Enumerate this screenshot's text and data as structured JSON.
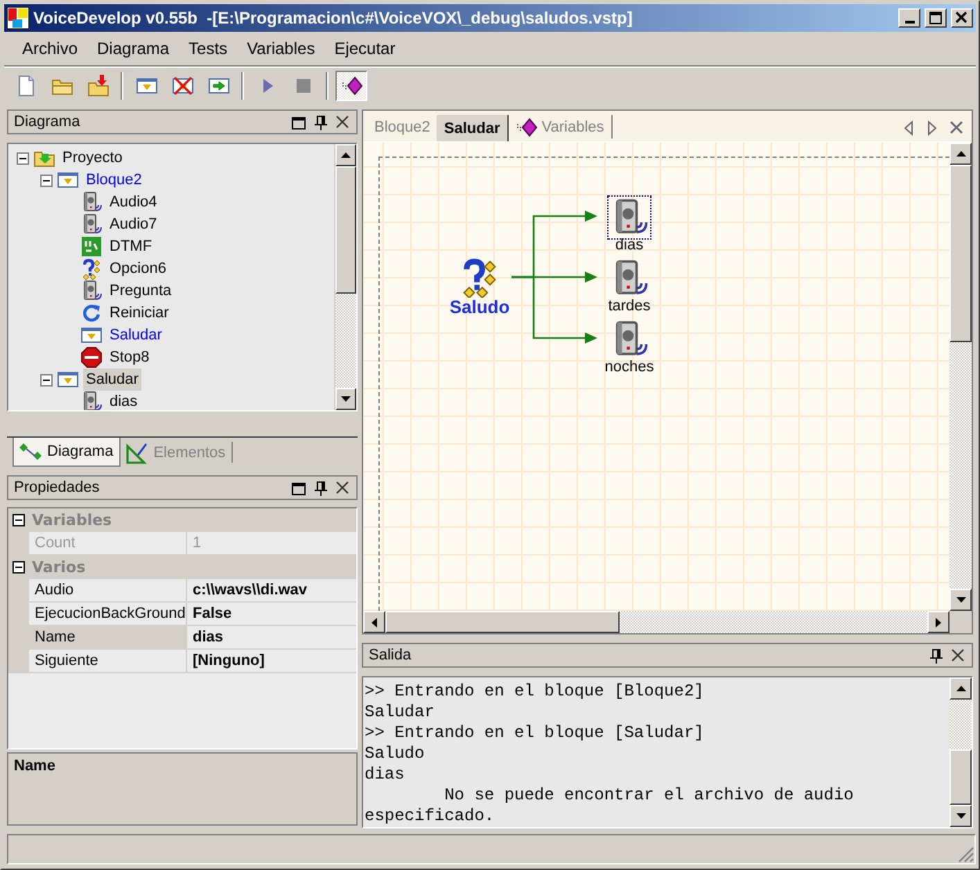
{
  "window": {
    "title": "VoiceDevelop v0.55b  -[E:\\Programacion\\c#\\VoiceVOX\\_debug\\saludos.vstp]"
  },
  "menu": [
    "Archivo",
    "Diagrama",
    "Tests",
    "Variables",
    "Ejecutar"
  ],
  "toolbar": [
    {
      "kind": "new",
      "pressed": false
    },
    {
      "kind": "open",
      "pressed": false
    },
    {
      "kind": "import",
      "pressed": false
    },
    {
      "kind": "separator"
    },
    {
      "kind": "block",
      "pressed": false
    },
    {
      "kind": "block-delete",
      "pressed": false
    },
    {
      "kind": "block-go",
      "pressed": false
    },
    {
      "kind": "separator"
    },
    {
      "kind": "play",
      "pressed": false
    },
    {
      "kind": "stop",
      "pressed": false
    },
    {
      "kind": "separator"
    },
    {
      "kind": "variables",
      "pressed": true
    }
  ],
  "diagram_panel": {
    "title": "Diagrama",
    "has_float_button": true,
    "tree": [
      {
        "label": "Proyecto",
        "kind": "project",
        "linked": false,
        "selected": false,
        "expanded": true,
        "children": [
          {
            "label": "Bloque2",
            "kind": "block",
            "linked": true,
            "selected": false,
            "expanded": true,
            "children": [
              {
                "label": "Audio4",
                "kind": "audio",
                "linked": false,
                "selected": false
              },
              {
                "label": "Audio7",
                "kind": "audio",
                "linked": false,
                "selected": false
              },
              {
                "label": "DTMF",
                "kind": "dtmf",
                "linked": false,
                "selected": false
              },
              {
                "label": "Opcion6",
                "kind": "option",
                "linked": false,
                "selected": false
              },
              {
                "label": "Pregunta",
                "kind": "audio",
                "linked": false,
                "selected": false
              },
              {
                "label": "Reiniciar",
                "kind": "restart",
                "linked": false,
                "selected": false
              },
              {
                "label": "Saludar",
                "kind": "block",
                "linked": true,
                "selected": false
              },
              {
                "label": "Stop8",
                "kind": "stop",
                "linked": false,
                "selected": false
              }
            ]
          },
          {
            "label": "Saludar",
            "kind": "block",
            "linked": false,
            "selected": true,
            "expanded": true,
            "children": [
              {
                "label": "dias",
                "kind": "audio",
                "linked": false,
                "selected": false
              }
            ]
          }
        ]
      }
    ],
    "tabs": [
      {
        "label": "Diagrama",
        "kind": "diagram",
        "selected": true
      },
      {
        "label": "Elementos",
        "kind": "elements",
        "selected": false
      }
    ]
  },
  "properties_panel": {
    "title": "Propiedades",
    "has_float_button": true,
    "categories": [
      {
        "name": "Variables",
        "expanded": true,
        "rows": [
          {
            "name": "Count",
            "value": "1",
            "disabled": true,
            "selected": false
          }
        ]
      },
      {
        "name": "Varios",
        "expanded": true,
        "rows": [
          {
            "name": "Audio",
            "value": "c:\\\\wavs\\\\di.wav",
            "disabled": false,
            "selected": false
          },
          {
            "name": "EjecucionBackGround",
            "value": "False",
            "disabled": false,
            "selected": false
          },
          {
            "name": "Name",
            "value": "dias",
            "disabled": false,
            "selected": true
          },
          {
            "name": "Siguiente",
            "value": "[Ninguno]",
            "disabled": false,
            "selected": false
          }
        ]
      }
    ],
    "description": {
      "title": "Name"
    }
  },
  "document_tabs": [
    {
      "label": "Bloque2",
      "kind": "plain",
      "selected": false
    },
    {
      "label": "Saludar",
      "kind": "plain",
      "selected": true
    },
    {
      "label": "Variables",
      "kind": "variables",
      "selected": false
    }
  ],
  "diagram": {
    "source": {
      "label": "Saludo",
      "kind": "option"
    },
    "targets": [
      {
        "label": "dias",
        "kind": "audio",
        "selected": true
      },
      {
        "label": "tardes",
        "kind": "audio",
        "selected": false
      },
      {
        "label": "noches",
        "kind": "audio",
        "selected": false
      }
    ]
  },
  "output_panel": {
    "title": "Salida",
    "has_float_button": false,
    "lines": [
      ">> Entrando en el bloque [Bloque2]",
      "Saludar",
      ">> Entrando en el bloque [Saludar]",
      "Saludo",
      "dias",
      "        No se puede encontrar el archivo de audio especificado."
    ]
  }
}
